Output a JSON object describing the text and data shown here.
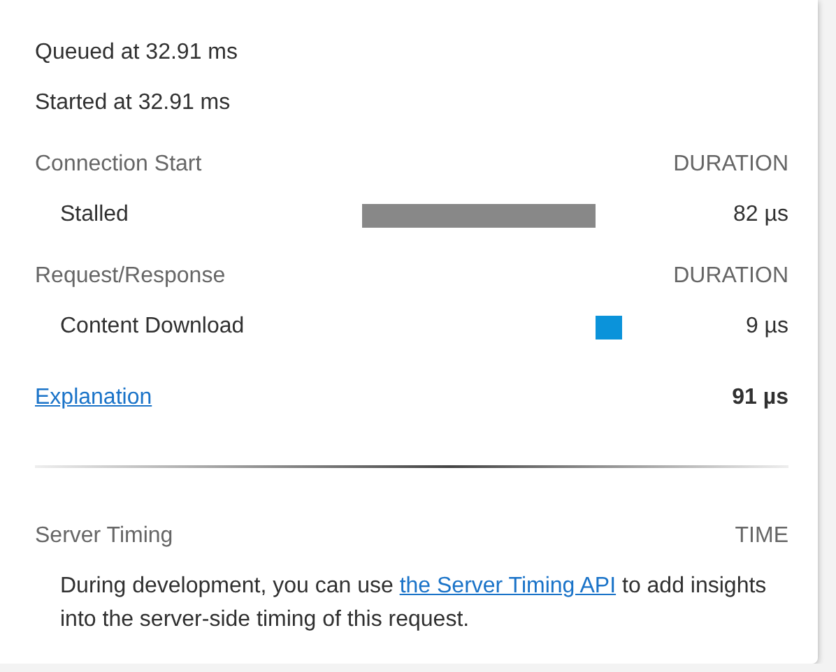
{
  "timestamps": [
    "Queued at 32.91 ms",
    "Started at 32.91 ms"
  ],
  "sections": [
    {
      "title": "Connection Start",
      "column": "DURATION",
      "rows": [
        {
          "label": "Stalled",
          "kind": "stalled",
          "value": "82 µs"
        }
      ]
    },
    {
      "title": "Request/Response",
      "column": "DURATION",
      "rows": [
        {
          "label": "Content Download",
          "kind": "download",
          "value": "9 µs"
        }
      ]
    }
  ],
  "footer": {
    "link": "Explanation",
    "total": "91 µs"
  },
  "server_timing": {
    "title": "Server Timing",
    "column": "TIME",
    "text_before": "During development, you can use ",
    "link": "the Server Timing API",
    "text_after": " to add insights into the server-side timing of this request."
  }
}
